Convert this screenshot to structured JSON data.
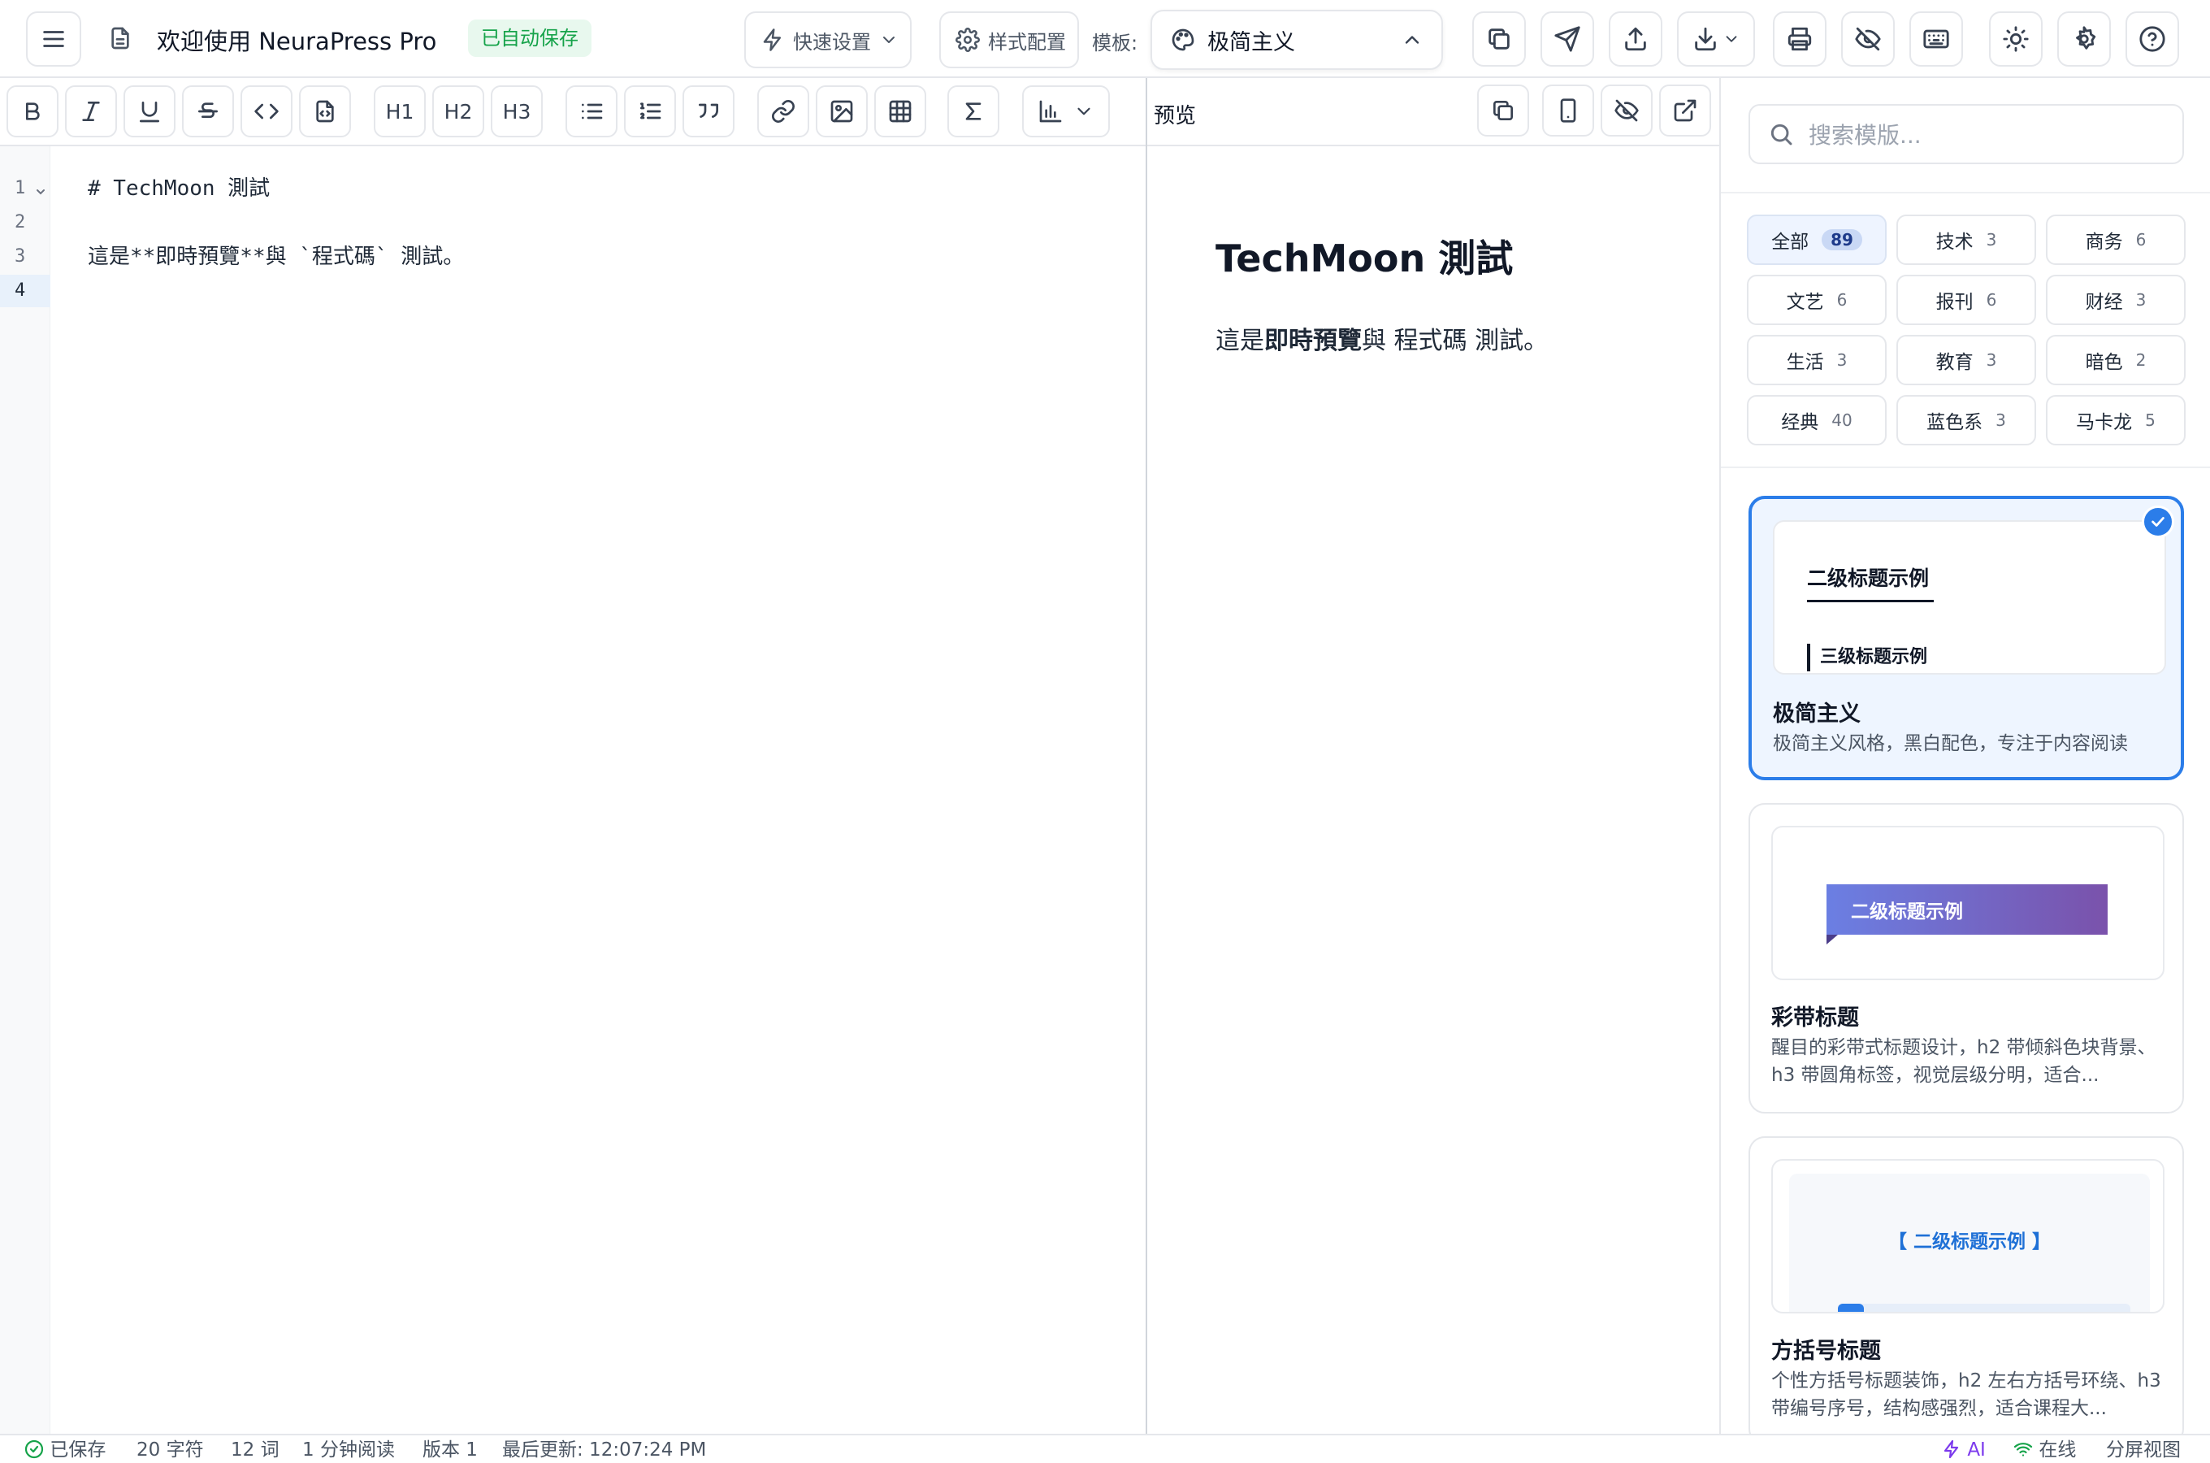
{
  "header": {
    "doc_title": "欢迎使用 NeuraPress Pro",
    "autosave_badge": "已自动保存",
    "quick_settings_label": "快速设置",
    "style_config_label": "样式配置",
    "template_label": "模板:",
    "template_selected": "极简主义",
    "icons": [
      "menu-icon",
      "document-icon",
      "zap-icon",
      "chevron-down-icon",
      "gear-icon",
      "palette-icon",
      "chevron-up-icon",
      "copy-icon",
      "send-icon",
      "upload-icon",
      "download-icon",
      "printer-icon",
      "eye-off-icon",
      "keyboard-icon",
      "sun-icon",
      "settings-icon",
      "help-circle-icon"
    ]
  },
  "toolbar": {
    "h1": "H1",
    "h2": "H2",
    "h3": "H3",
    "icons": [
      "bold-icon",
      "italic-icon",
      "underline-icon",
      "strikethrough-icon",
      "code-icon",
      "file-code-icon",
      "list-icon",
      "ordered-list-icon",
      "quote-icon",
      "link-icon",
      "image-icon",
      "table-icon",
      "sigma-icon",
      "chart-icon",
      "chevron-down-icon"
    ]
  },
  "editor": {
    "line_numbers": [
      "1",
      "2",
      "3",
      "4"
    ],
    "lines": [
      "# TechMoon 測試",
      "",
      "這是**即時預覽**與 `程式碼` 測試。",
      ""
    ]
  },
  "preview": {
    "label": "预览",
    "h1": "TechMoon 測試",
    "p_before": "這是",
    "p_bold": "即時預覽",
    "p_mid": "與 ",
    "p_code": "程式碼",
    "p_after": " 測試。"
  },
  "panel": {
    "search_placeholder": "搜索模版...",
    "categories": [
      {
        "label": "全部",
        "count": "89"
      },
      {
        "label": "技术",
        "count": "3"
      },
      {
        "label": "商务",
        "count": "6"
      },
      {
        "label": "文艺",
        "count": "6"
      },
      {
        "label": "报刊",
        "count": "6"
      },
      {
        "label": "财经",
        "count": "3"
      },
      {
        "label": "生活",
        "count": "3"
      },
      {
        "label": "教育",
        "count": "3"
      },
      {
        "label": "暗色",
        "count": "2"
      },
      {
        "label": "经典",
        "count": "40"
      },
      {
        "label": "蓝色系",
        "count": "3"
      },
      {
        "label": "马卡龙",
        "count": "5"
      }
    ],
    "templates": [
      {
        "name": "极简主义",
        "desc": "极简主义风格，黑白配色，专注于内容阅读",
        "sample_h2": "二级标题示例",
        "sample_h3": "三级标题示例"
      },
      {
        "name": "彩带标题",
        "desc": "醒目的彩带式标题设计，h2 带倾斜色块背景、h3 带圆角标签，视觉层级分明，适合...",
        "sample_h2": "二级标题示例"
      },
      {
        "name": "方括号标题",
        "desc": "个性方括号标题装饰，h2 左右方括号环绕、h3 带编号序号，结构感强烈，适合课程大...",
        "sample_h2": "【 二级标题示例 】"
      }
    ]
  },
  "status": {
    "saved": "已保存",
    "chars": "20 字符",
    "words": "12 词",
    "read_time": "1 分钟阅读",
    "version": "版本 1",
    "last_update": "最后更新: 12:07:24 PM",
    "ai": "AI",
    "online": "在线",
    "view_mode": "分屏视图"
  },
  "colors": {
    "accent": "#2b7de9",
    "autosave_green": "#16a34a",
    "ai_purple": "#7c3aed",
    "online_green": "#16a34a"
  }
}
